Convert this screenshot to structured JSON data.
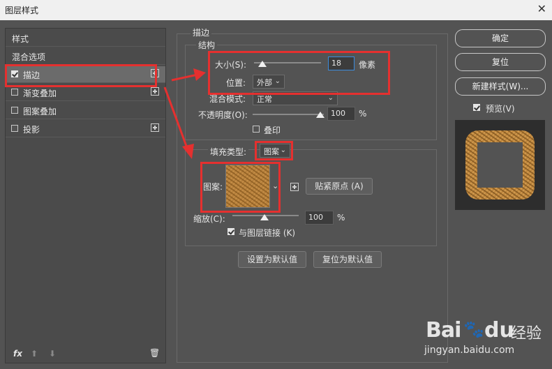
{
  "window": {
    "title": "图层样式",
    "close": "✕"
  },
  "left_panel": {
    "items": [
      {
        "label": "样式",
        "has_checkbox": false,
        "has_plus": false
      },
      {
        "label": "混合选项",
        "has_checkbox": false,
        "has_plus": false
      },
      {
        "label": "描边",
        "has_checkbox": true,
        "checked": true,
        "has_plus": true,
        "selected": true
      },
      {
        "label": "渐变叠加",
        "has_checkbox": true,
        "checked": false,
        "has_plus": true
      },
      {
        "label": "图案叠加",
        "has_checkbox": true,
        "checked": false,
        "has_plus": false
      },
      {
        "label": "投影",
        "has_checkbox": true,
        "checked": false,
        "has_plus": true
      }
    ],
    "footer": {
      "fx": "fx",
      "up": "⬆",
      "down": "⬇",
      "trash": "🗑"
    }
  },
  "stroke": {
    "section_title": "描边",
    "structure_title": "结构",
    "size_label": "大小(S):",
    "size_value": "18",
    "size_unit": "像素",
    "position_label": "位置:",
    "position_value": "外部",
    "blend_label": "混合模式:",
    "blend_value": "正常",
    "opacity_label": "不透明度(O):",
    "opacity_value": "100",
    "opacity_unit": "%",
    "overprint_label": "叠印",
    "fill_type_label": "填充类型:",
    "fill_type_value": "图案",
    "pattern_label": "图案:",
    "snap_origin_label": "贴紧原点 (A)",
    "scale_label": "缩放(C):",
    "scale_value": "100",
    "scale_unit": "%",
    "link_label": "与图层链接 (K)",
    "link_checked": true,
    "set_default": "设置为默认值",
    "reset_default": "复位为默认值"
  },
  "right_panel": {
    "ok": "确定",
    "reset": "复位",
    "new_style": "新建样式(W)...",
    "preview_label": "预览(V)",
    "preview_checked": true
  },
  "watermark": {
    "logo_left": "Bai",
    "logo_right": "du",
    "brand": "经验",
    "url": "jingyan.baidu.com"
  },
  "colors": {
    "highlight": "#e5302f",
    "panel": "#535353"
  }
}
